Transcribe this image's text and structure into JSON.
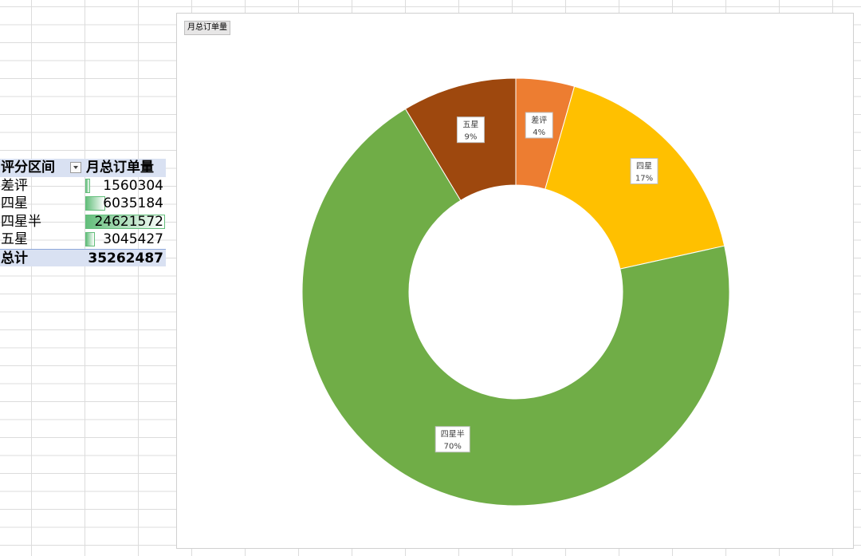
{
  "pivot": {
    "header": {
      "col1": "评分区间",
      "col2": "月总订单量"
    },
    "rows": [
      {
        "label": "差评",
        "value": "1560304",
        "fraction": 0.0634
      },
      {
        "label": "四星",
        "value": "6035184",
        "fraction": 0.2451
      },
      {
        "label": "四星半",
        "value": "24621572",
        "fraction": 1.0
      },
      {
        "label": "五星",
        "value": "3045427",
        "fraction": 0.1237
      }
    ],
    "total": {
      "label": "总计",
      "value": "35262487"
    }
  },
  "chart": {
    "field_button": "月总订单量"
  },
  "chart_data": {
    "type": "pie",
    "variant": "donut",
    "categories": [
      "差评",
      "四星",
      "四星半",
      "五星"
    ],
    "values": [
      1560304,
      6035184,
      24621572,
      3045427
    ],
    "percent_labels": [
      "4%",
      "17%",
      "70%",
      "9%"
    ],
    "colors": [
      "#ed7d31",
      "#ffc000",
      "#70ad47",
      "#9e480e"
    ],
    "legend": "none"
  }
}
